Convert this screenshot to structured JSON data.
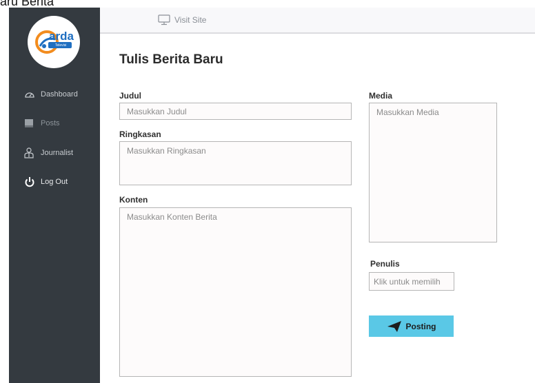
{
  "caption": "aru Berita",
  "sidebar": {
    "logo_text": "arda",
    "logo_subtext": "Televisi",
    "items": [
      {
        "label": "Dashboard",
        "icon": "speedometer-icon"
      },
      {
        "label": "Posts",
        "icon": "book-icon"
      },
      {
        "label": "Journalist",
        "icon": "user-tie-icon"
      },
      {
        "label": "Log Out",
        "icon": "power-icon"
      }
    ]
  },
  "topbar": {
    "visit_label": "Visit Site",
    "visit_icon": "monitor-icon"
  },
  "page": {
    "title": "Tulis Berita Baru"
  },
  "form": {
    "judul": {
      "label": "Judul",
      "placeholder": "Masukkan Judul"
    },
    "ringkasan": {
      "label": "Ringkasan",
      "placeholder": "Masukkan Ringkasan"
    },
    "konten": {
      "label": "Konten",
      "placeholder": "Masukkan Konten Berita"
    },
    "media": {
      "label": "Media",
      "placeholder": "Masukkan Media"
    },
    "penulis": {
      "label": "Penulis",
      "placeholder": "Klik untuk memilih"
    },
    "submit_label": "Posting"
  },
  "colors": {
    "sidebar_bg": "#343a40",
    "accent_button": "#5ac8e6",
    "logo_blue": "#1f6fc1",
    "logo_orange": "#f28c1e"
  }
}
